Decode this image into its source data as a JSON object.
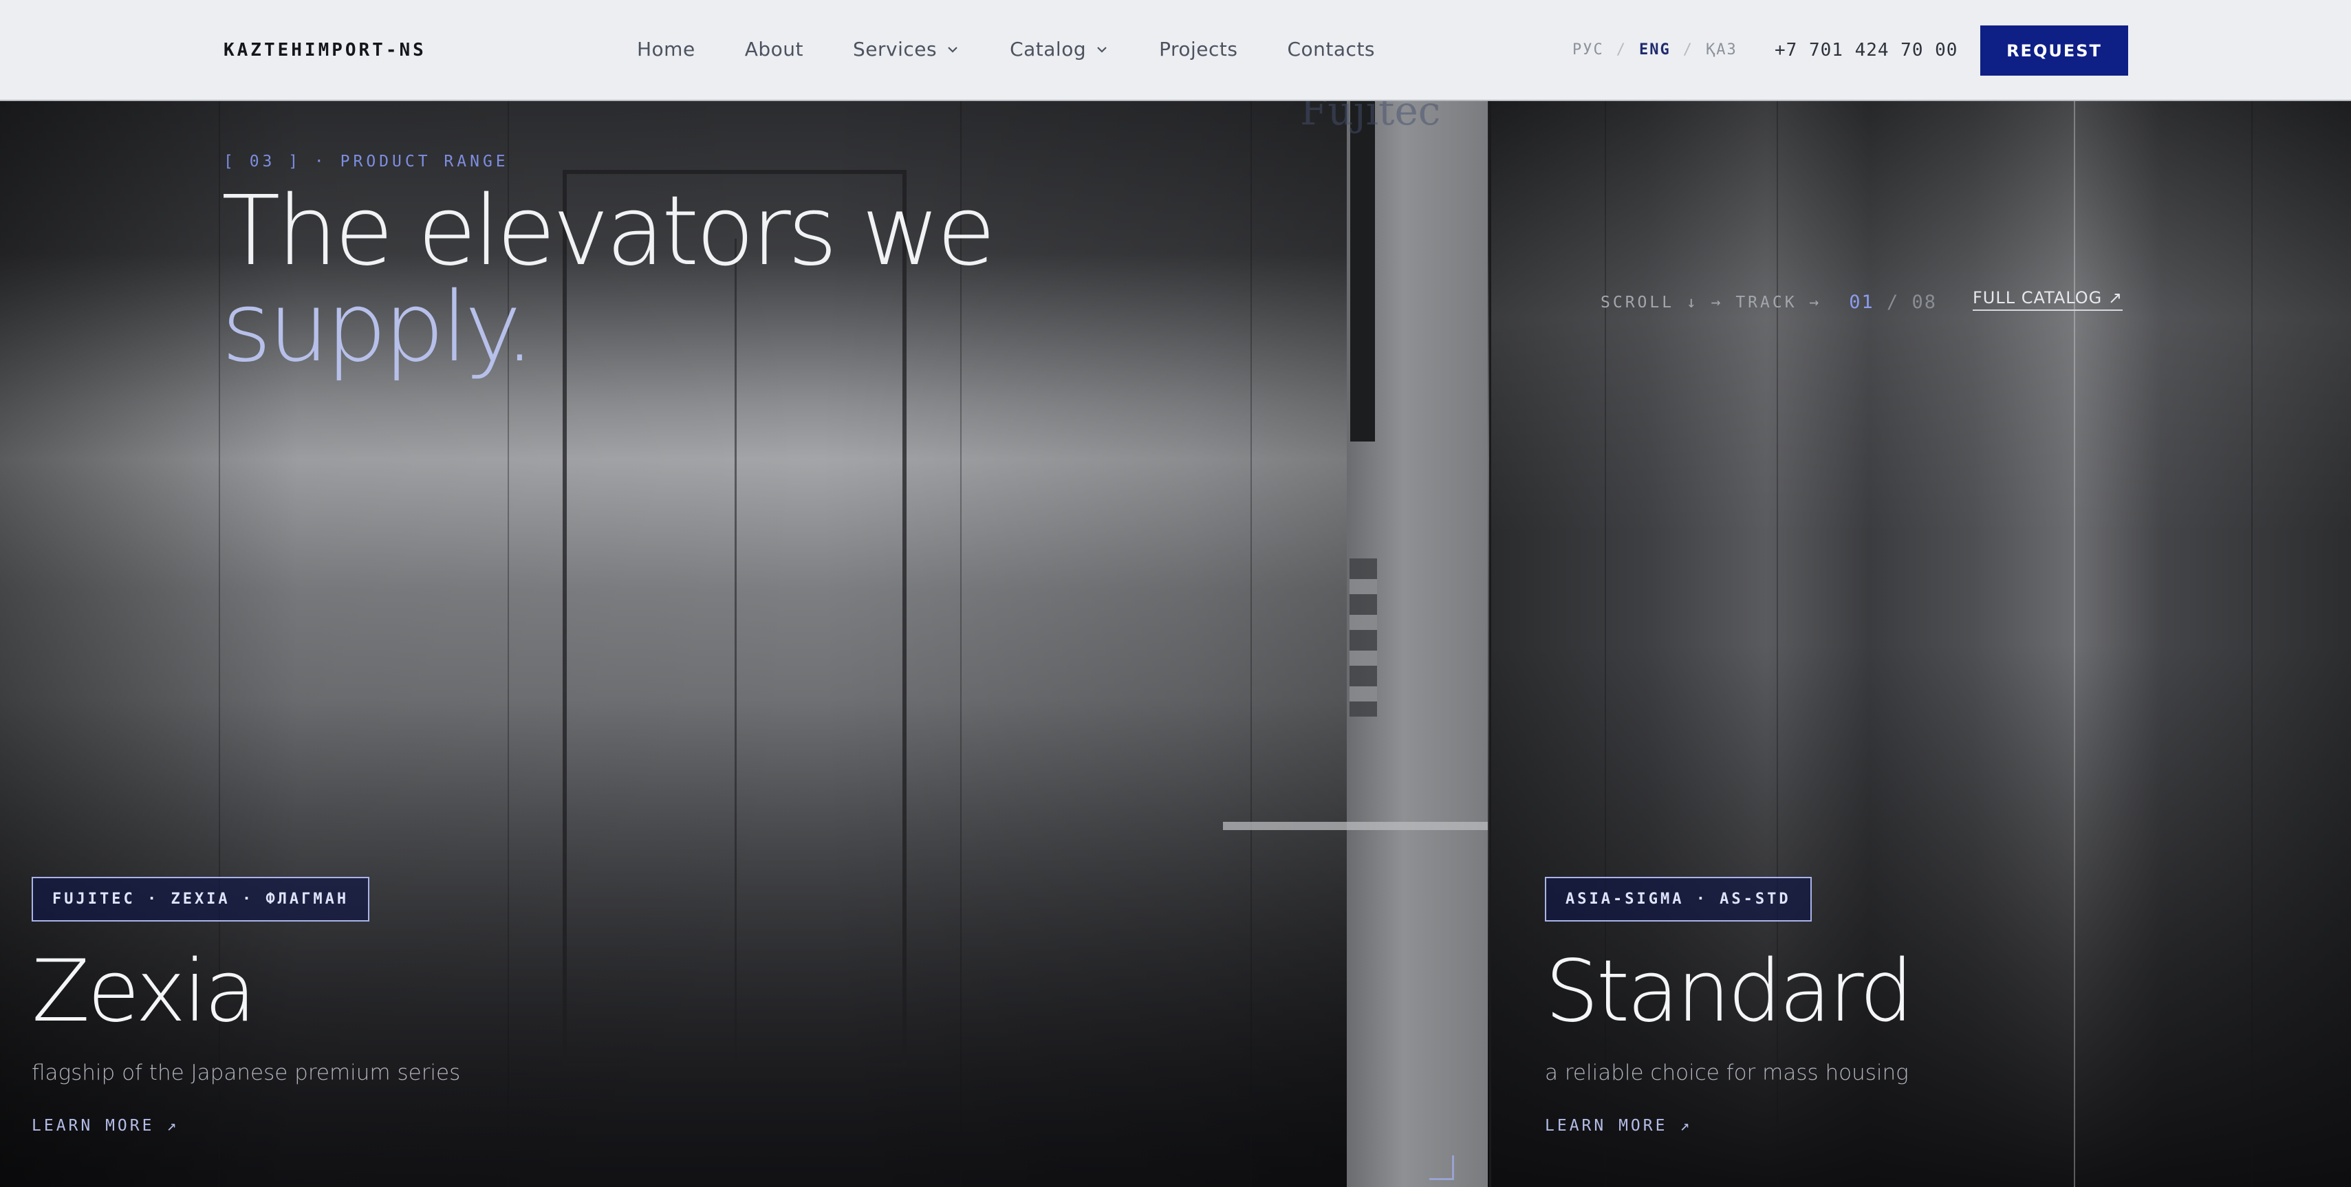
{
  "header": {
    "logo": "KAZTEHIMPORT-NS",
    "nav": [
      {
        "label": "Home"
      },
      {
        "label": "About"
      },
      {
        "label": "Services"
      },
      {
        "label": "Catalog"
      },
      {
        "label": "Projects"
      },
      {
        "label": "Contacts"
      }
    ],
    "languages": [
      "РУС",
      "ENG",
      "ҚАЗ"
    ],
    "active_language": "ENG",
    "language_separator": "/",
    "phone": "+7 701 424 70 00",
    "request_label": "REQUEST"
  },
  "hero": {
    "brand_in_photo": "Fujitec",
    "eyebrow": "[ 03 ] · PRODUCT RANGE",
    "headline_line1": "The elevators we",
    "headline_line2": "supply.",
    "tracker_label": "SCROLL ↓ → TRACK →",
    "tracker_current": "01",
    "tracker_separator": " / ",
    "tracker_total": "08",
    "full_catalog": "FULL CATALOG ↗"
  },
  "cards": [
    {
      "tag": "FUJITEC · ZEXIA · ФЛАГМАН",
      "title": "Zexia",
      "subtitle": "flagship of the Japanese premium series",
      "link": "LEARN MORE ↗"
    },
    {
      "tag": "ASIA-SIGMA · AS-STD",
      "title": "Standard",
      "subtitle": "a reliable choice for mass housing",
      "link": "LEARN MORE ↗"
    }
  ],
  "colors": {
    "brand_blue": "#0e1f86",
    "accent_lavender": "#b7c0ea",
    "eyebrow_blue": "#7d8ee0",
    "header_bg": "#eceef1"
  }
}
